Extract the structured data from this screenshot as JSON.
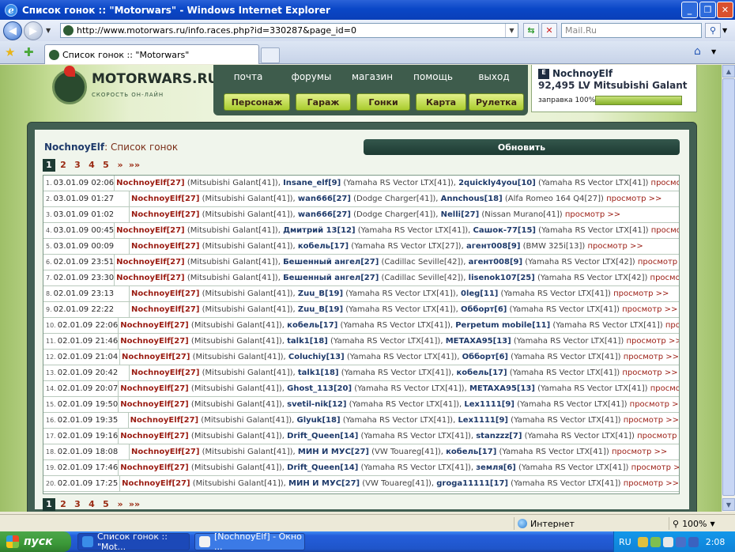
{
  "window": {
    "title": "Список гонок :: \"Motorwars\" - Windows Internet Explorer"
  },
  "address": {
    "url": "http://www.motorwars.ru/info.races.php?id=330287&page_id=0",
    "search_placeholder": "Mail.Ru"
  },
  "tab": {
    "title": "Список гонок :: \"Motorwars\""
  },
  "site": {
    "logo": "MOTORWARS.RU",
    "logo_sub": "СКОРОСТЬ ОН-ЛАЙН",
    "top_menu": [
      "почта",
      "форумы",
      "магазин",
      "помощь",
      "выход"
    ],
    "nav_buttons": [
      "Персонаж",
      "Гараж",
      "Гонки",
      "Карта",
      "Рулетка"
    ]
  },
  "user": {
    "icon": "E",
    "name": "NochnoyElf",
    "car": "92,495 LV Mitsubishi Galant",
    "fuel_label": "заправка 100%",
    "fuel_fraction": 1.0
  },
  "header": {
    "owner": "NochnoyElf",
    "sep": ":",
    "title": " Список гонок",
    "refresh": "Обновить"
  },
  "pager": [
    {
      "label": "1",
      "current": true
    },
    {
      "label": "2"
    },
    {
      "label": "3"
    },
    {
      "label": "4"
    },
    {
      "label": "5"
    },
    {
      "label": "»"
    },
    {
      "label": "»»"
    }
  ],
  "races": [
    {
      "n": "1.",
      "date": "03.01.09 02:06",
      "p1": "NochnoyElf[27]",
      "c1": " (Mitsubishi Galant[41]), ",
      "p2": "Insane_elf[9]",
      "c2": " (Yamaha RS Vector LTX[41]), ",
      "p3": "2quickly4you[10]",
      "c3": " (Yamaha RS Vector LTX[41]) ",
      "view": "просмотр >>"
    },
    {
      "n": "2.",
      "date": "03.01.09 01:27",
      "p1": "NochnoyElf[27]",
      "c1": " (Mitsubishi Galant[41]), ",
      "p2": "wan666[27]",
      "c2": " (Dodge Charger[41]), ",
      "p3": "Annchous[18]",
      "c3": " (Alfa Romeo 164 Q4[27]) ",
      "view": "просмотр >>"
    },
    {
      "n": "3.",
      "date": "03.01.09 01:02",
      "p1": "NochnoyElf[27]",
      "c1": " (Mitsubishi Galant[41]), ",
      "p2": "wan666[27]",
      "c2": " (Dodge Charger[41]), ",
      "p3": "Nelli[27]",
      "c3": " (Nissan Murano[41]) ",
      "view": "просмотр >>"
    },
    {
      "n": "4.",
      "date": "03.01.09 00:45",
      "p1": "NochnoyElf[27]",
      "c1": " (Mitsubishi Galant[41]), ",
      "p2": "Дмитрий 13[12]",
      "c2": " (Yamaha RS Vector LTX[41]), ",
      "p3": "Сашок-77[15]",
      "c3": " (Yamaha RS Vector LTX[41]) ",
      "view": "просмотр >>"
    },
    {
      "n": "5.",
      "date": "03.01.09 00:09",
      "p1": "NochnoyElf[27]",
      "c1": " (Mitsubishi Galant[41]), ",
      "p2": "кобель[17]",
      "c2": " (Yamaha RS Vector LTX[27]), ",
      "p3": "агент008[9]",
      "c3": " (BMW 325i[13]) ",
      "view": "просмотр >>"
    },
    {
      "n": "6.",
      "date": "02.01.09 23:51",
      "p1": "NochnoyElf[27]",
      "c1": " (Mitsubishi Galant[41]), ",
      "p2": "Бешенный ангел[27]",
      "c2": " (Cadillac Seville[42]), ",
      "p3": "агент008[9]",
      "c3": " (Yamaha RS Vector LTX[42]) ",
      "view": "просмотр >>"
    },
    {
      "n": "7.",
      "date": "02.01.09 23:30",
      "p1": "NochnoyElf[27]",
      "c1": " (Mitsubishi Galant[41]), ",
      "p2": "Бешенный ангел[27]",
      "c2": " (Cadillac Seville[42]), ",
      "p3": "lisenok107[25]",
      "c3": " (Yamaha RS Vector LTX[42]) ",
      "view": "просмотр >>"
    },
    {
      "n": "8.",
      "date": "02.01.09 23:13",
      "p1": "NochnoyElf[27]",
      "c1": " (Mitsubishi Galant[41]), ",
      "p2": "Zuu_B[19]",
      "c2": " (Yamaha RS Vector LTX[41]), ",
      "p3": "0leg[11]",
      "c3": " (Yamaha RS Vector LTX[41]) ",
      "view": "просмотр >>"
    },
    {
      "n": "9.",
      "date": "02.01.09 22:22",
      "p1": "NochnoyElf[27]",
      "c1": " (Mitsubishi Galant[41]), ",
      "p2": "Zuu_B[19]",
      "c2": " (Yamaha RS Vector LTX[41]), ",
      "p3": "Обборт[6]",
      "c3": " (Yamaha RS Vector LTX[41]) ",
      "view": "просмотр >>"
    },
    {
      "n": "10.",
      "date": "02.01.09 22:06",
      "p1": "NochnoyElf[27]",
      "c1": " (Mitsubishi Galant[41]), ",
      "p2": "кобель[17]",
      "c2": " (Yamaha RS Vector LTX[41]), ",
      "p3": "Perpetum mobile[11]",
      "c3": " (Yamaha RS Vector LTX[41]) ",
      "view": "просмотр >>"
    },
    {
      "n": "11.",
      "date": "02.01.09 21:46",
      "p1": "NochnoyElf[27]",
      "c1": " (Mitsubishi Galant[41]), ",
      "p2": "talk1[18]",
      "c2": " (Yamaha RS Vector LTX[41]), ",
      "p3": "METAXA95[13]",
      "c3": " (Yamaha RS Vector LTX[41]) ",
      "view": "просмотр >>"
    },
    {
      "n": "12.",
      "date": "02.01.09 21:04",
      "p1": "NochnoyElf[27]",
      "c1": " (Mitsubishi Galant[41]), ",
      "p2": "Coluchiy[13]",
      "c2": " (Yamaha RS Vector LTX[41]), ",
      "p3": "Обборт[6]",
      "c3": " (Yamaha RS Vector LTX[41]) ",
      "view": "просмотр >>"
    },
    {
      "n": "13.",
      "date": "02.01.09 20:42",
      "p1": "NochnoyElf[27]",
      "c1": " (Mitsubishi Galant[41]), ",
      "p2": "talk1[18]",
      "c2": " (Yamaha RS Vector LTX[41]), ",
      "p3": "кобель[17]",
      "c3": " (Yamaha RS Vector LTX[41]) ",
      "view": "просмотр >>"
    },
    {
      "n": "14.",
      "date": "02.01.09 20:07",
      "p1": "NochnoyElf[27]",
      "c1": " (Mitsubishi Galant[41]), ",
      "p2": "Ghost_113[20]",
      "c2": " (Yamaha RS Vector LTX[41]), ",
      "p3": "METAXA95[13]",
      "c3": " (Yamaha RS Vector LTX[41]) ",
      "view": "просмотр >>"
    },
    {
      "n": "15.",
      "date": "02.01.09 19:50",
      "p1": "NochnoyElf[27]",
      "c1": " (Mitsubishi Galant[41]), ",
      "p2": "svetil-nik[12]",
      "c2": " (Yamaha RS Vector LTX[41]), ",
      "p3": "Lex1111[9]",
      "c3": " (Yamaha RS Vector LTX[41]) ",
      "view": "просмотр >>"
    },
    {
      "n": "16.",
      "date": "02.01.09 19:35",
      "p1": "NochnoyElf[27]",
      "c1": " (Mitsubishi Galant[41]), ",
      "p2": "Glyuk[18]",
      "c2": " (Yamaha RS Vector LTX[41]), ",
      "p3": "Lex1111[9]",
      "c3": " (Yamaha RS Vector LTX[41]) ",
      "view": "просмотр >>"
    },
    {
      "n": "17.",
      "date": "02.01.09 19:16",
      "p1": "NochnoyElf[27]",
      "c1": " (Mitsubishi Galant[41]), ",
      "p2": "Drift_Queen[14]",
      "c2": " (Yamaha RS Vector LTX[41]), ",
      "p3": "stanzzz[7]",
      "c3": " (Yamaha RS Vector LTX[41]) ",
      "view": "просмотр >>"
    },
    {
      "n": "18.",
      "date": "02.01.09 18:08",
      "p1": "NochnoyElf[27]",
      "c1": " (Mitsubishi Galant[41]), ",
      "p2": "МИН И МУС[27]",
      "c2": " (VW Touareg[41]), ",
      "p3": "кобель[17]",
      "c3": " (Yamaha RS Vector LTX[41]) ",
      "view": "просмотр >>"
    },
    {
      "n": "19.",
      "date": "02.01.09 17:46",
      "p1": "NochnoyElf[27]",
      "c1": " (Mitsubishi Galant[41]), ",
      "p2": "Drift_Queen[14]",
      "c2": " (Yamaha RS Vector LTX[41]), ",
      "p3": "земля[6]",
      "c3": " (Yamaha RS Vector LTX[41]) ",
      "view": "просмотр >>"
    },
    {
      "n": "20.",
      "date": "02.01.09 17:25",
      "p1": "NochnoyElf[27]",
      "c1": " (Mitsubishi Galant[41]), ",
      "p2": "МИН И МУС[27]",
      "c2": " (VW Touareg[41]), ",
      "p3": "groga11111[17]",
      "c3": " (Yamaha RS Vector LTX[41]) ",
      "view": "просмотр >>"
    }
  ],
  "status": {
    "zone": "Интернет",
    "zoom": "100%"
  },
  "taskbar": {
    "start": "пуск",
    "tasks": [
      "Список гонок :: \"Mot...",
      "[NochnoyElf] - Окно ..."
    ],
    "lang": "RU",
    "time": "2:08"
  }
}
